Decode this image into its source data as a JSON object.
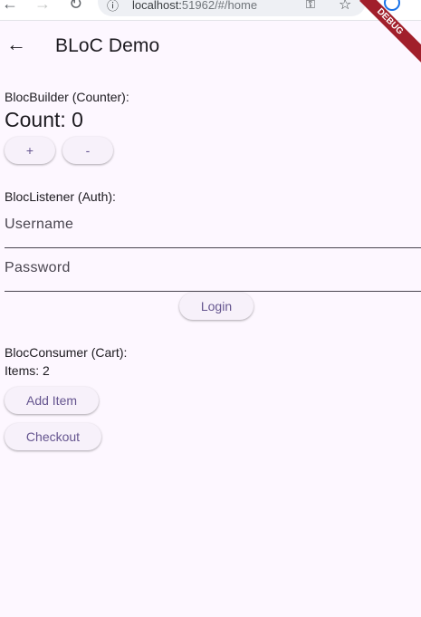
{
  "browser": {
    "url_host": "localhost:",
    "url_rest": "51962/#/home"
  },
  "appbar": {
    "title": "BLoC Demo",
    "debug_banner": "DEBUG"
  },
  "counter": {
    "section_label": "BlocBuilder (Counter):",
    "count_text": "Count: 0",
    "increment_label": "+",
    "decrement_label": "-"
  },
  "auth": {
    "section_label": "BlocListener (Auth):",
    "username_placeholder": "Username",
    "password_placeholder": "Password",
    "login_label": "Login"
  },
  "cart": {
    "section_label": "BlocConsumer (Cart):",
    "items_text": "Items: 2",
    "add_item_label": "Add Item",
    "checkout_label": "Checkout"
  }
}
